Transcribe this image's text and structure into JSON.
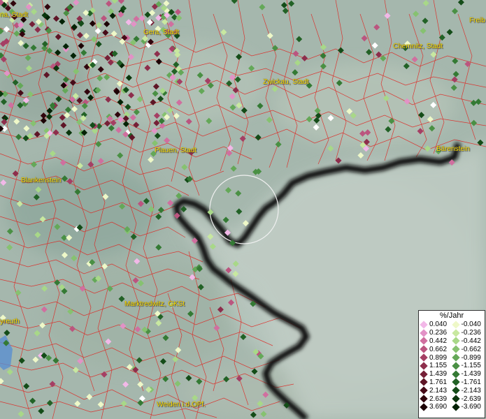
{
  "places": [
    {
      "name": "na, Stadt"
    },
    {
      "name": "Gera, Stadt"
    },
    {
      "name": "Freib"
    },
    {
      "name": "Chemnitz, Stadt"
    },
    {
      "name": "Zwickau, Stadt"
    },
    {
      "name": "Plauen, Stadt"
    },
    {
      "name": "Bärenstein"
    },
    {
      "name": "Blankenstein"
    },
    {
      "name": "Marktredwitz, GKSt"
    },
    {
      "name": "yreuth"
    },
    {
      "name": "Weiden i.d.OPf."
    }
  ],
  "legend": {
    "title": "%/Jahr",
    "positive": [
      {
        "value": "0.040",
        "color": "#f2b8e8"
      },
      {
        "value": "0.236",
        "color": "#e292c6"
      },
      {
        "value": "0.442",
        "color": "#d06f9f"
      },
      {
        "value": "0.662",
        "color": "#bb557f"
      },
      {
        "value": "0.899",
        "color": "#a53f64"
      },
      {
        "value": "1.155",
        "color": "#8e2e4c"
      },
      {
        "value": "1.439",
        "color": "#762037"
      },
      {
        "value": "1.761",
        "color": "#5e1526"
      },
      {
        "value": "2.143",
        "color": "#470b18"
      },
      {
        "value": "2.639",
        "color": "#31050d"
      },
      {
        "value": "3.690",
        "color": "#1c0205"
      }
    ],
    "negative": [
      {
        "value": "-0.040",
        "color": "#eef8c8"
      },
      {
        "value": "-0.236",
        "color": "#c8e8a0"
      },
      {
        "value": "-0.442",
        "color": "#a8d888"
      },
      {
        "value": "-0.662",
        "color": "#86c270"
      },
      {
        "value": "-0.899",
        "color": "#64a858"
      },
      {
        "value": "-1.155",
        "color": "#4a9044"
      },
      {
        "value": "-1.439",
        "color": "#347a34"
      },
      {
        "value": "-1.761",
        "color": "#226226"
      },
      {
        "value": "-2.143",
        "color": "#144c18"
      },
      {
        "value": "-2.639",
        "color": "#0a360c"
      },
      {
        "value": "-3.690",
        "color": "#032205"
      }
    ]
  }
}
